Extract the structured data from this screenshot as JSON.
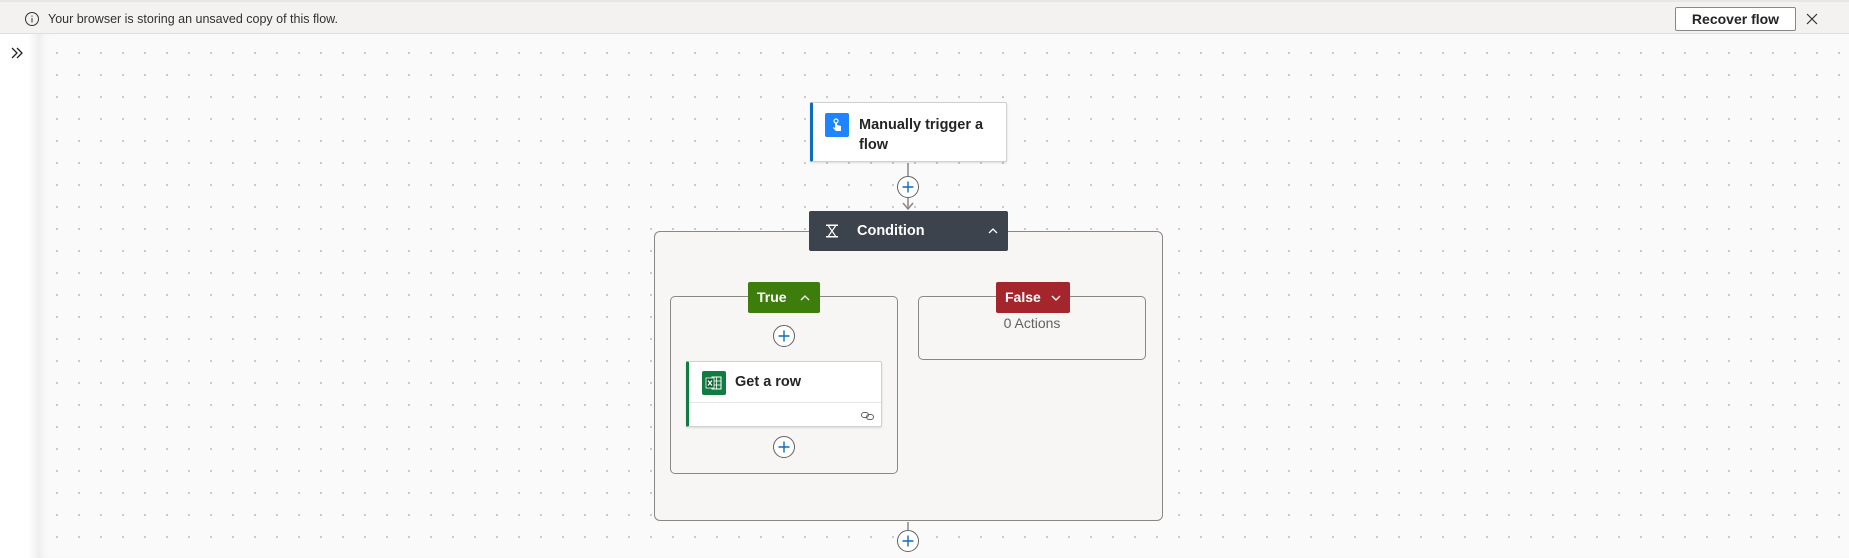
{
  "notification": {
    "message": "Your browser is storing an unsaved copy of this flow.",
    "recover_label": "Recover flow",
    "info_icon": "info-icon",
    "close_icon": "close-icon"
  },
  "sidebar": {
    "expand_icon": "double-chevron-right-icon"
  },
  "flow": {
    "trigger": {
      "title": "Manually trigger a flow",
      "icon": "manual-trigger-icon",
      "accent": "#0f6cbd"
    },
    "condition": {
      "title": "Condition",
      "icon": "condition-icon",
      "header_color": "#3c434c",
      "true_branch": {
        "label": "True",
        "color": "#3d7d0c",
        "actions": [
          {
            "title": "Get a row",
            "icon": "excel-icon",
            "accent": "#107c41"
          }
        ]
      },
      "false_branch": {
        "label": "False",
        "color": "#a4262c",
        "summary": "0 Actions"
      }
    }
  }
}
